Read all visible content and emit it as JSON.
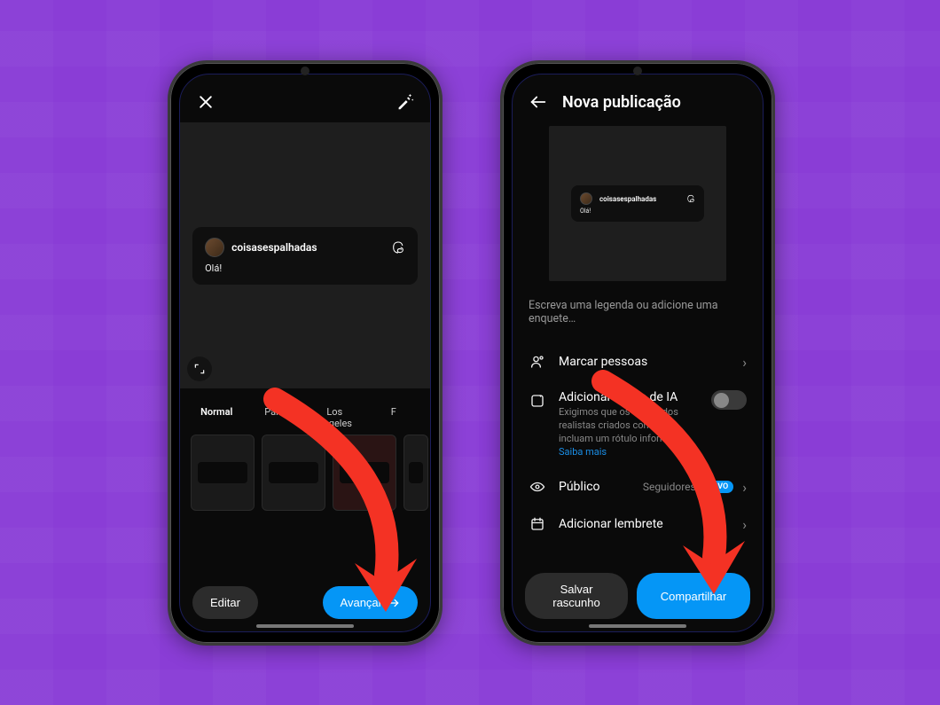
{
  "colors": {
    "accent": "#0596f6",
    "bg": "#8a3dd6"
  },
  "post": {
    "username": "coisasespalhadas",
    "greeting": "Olá!"
  },
  "left": {
    "filters": {
      "f0": "Normal",
      "f1": "Paris",
      "f2": "Los Angeles",
      "f3": "F"
    },
    "edit_label": "Editar",
    "next_label": "Avançar"
  },
  "right": {
    "title": "Nova publicação",
    "caption_placeholder": "Escreva uma legenda ou adicione uma enquete…",
    "tag_people_label": "Marcar pessoas",
    "ai_label_title": "Adicionar rótulo de IA",
    "ai_label_body_1": "Exigimos que os conteúdos realistas criados com IA incluam um rótulo informativo.",
    "ai_label_link": "Saiba mais",
    "audience_label": "Público",
    "audience_value": "Seguidores",
    "audience_badge": "NOVO",
    "reminder_label": "Adicionar lembrete",
    "draft_label": "Salvar rascunho",
    "share_label": "Compartilhar"
  }
}
